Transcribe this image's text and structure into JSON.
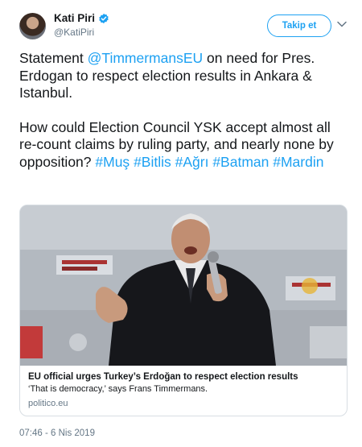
{
  "author": {
    "name": "Kati Piri",
    "handle": "@KatiPiri"
  },
  "follow_button_label": "Takip et",
  "tweet": {
    "p1_before": "Statement ",
    "mention": "@TimmermansEU",
    "p1_after": " on need for Pres. Erdogan to respect election results in Ankara & Istanbul.",
    "p2_text": "How could Election Council YSK accept almost all re-count claims by ruling party, and nearly none by opposition? ",
    "hashtags": [
      "#Muş",
      "#Bitlis",
      "#Ağrı",
      "#Batman",
      "#Mardin"
    ]
  },
  "card": {
    "title": "EU official urges Turkey’s Erdoğan to respect election results",
    "description": "‘That is democracy,’ says Frans Timmermans.",
    "domain": "politico.eu"
  },
  "timestamp": "07:46 - 6 Nis 2019",
  "colors": {
    "link": "#1da1f2",
    "text": "#14171a",
    "muted": "#657786",
    "border": "#d8dee3"
  },
  "icons": [
    "verified-badge-icon",
    "chevron-down-icon"
  ]
}
